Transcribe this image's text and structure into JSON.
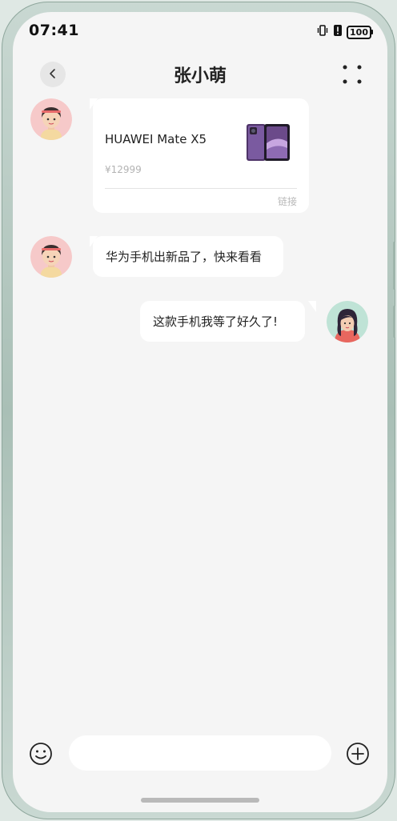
{
  "status_bar": {
    "time": "07:41",
    "battery": "100"
  },
  "header": {
    "title": "张小萌"
  },
  "messages": [
    {
      "type": "product-card",
      "sender": "incoming",
      "product_name": "HUAWEI Mate X5",
      "price": "¥12999",
      "link_label": "链接"
    },
    {
      "type": "text",
      "sender": "incoming",
      "text": "华为手机出新品了，快来看看"
    },
    {
      "type": "text",
      "sender": "outgoing",
      "text": "这款手机我等了好久了!"
    }
  ],
  "input": {
    "placeholder": ""
  },
  "icons": {
    "back": "chevron-left-icon",
    "more": "four-dots-icon",
    "emoji": "smiley-icon",
    "plus": "plus-circle-icon",
    "vibrate": "vibrate-icon",
    "alert": "alert-icon"
  },
  "colors": {
    "background": "#f5f5f5",
    "bubble": "#ffffff",
    "incoming_avatar_bg": "#f6c9c9",
    "outgoing_avatar_bg": "#bfe3d6",
    "product_purple": "#6b4a8a"
  }
}
